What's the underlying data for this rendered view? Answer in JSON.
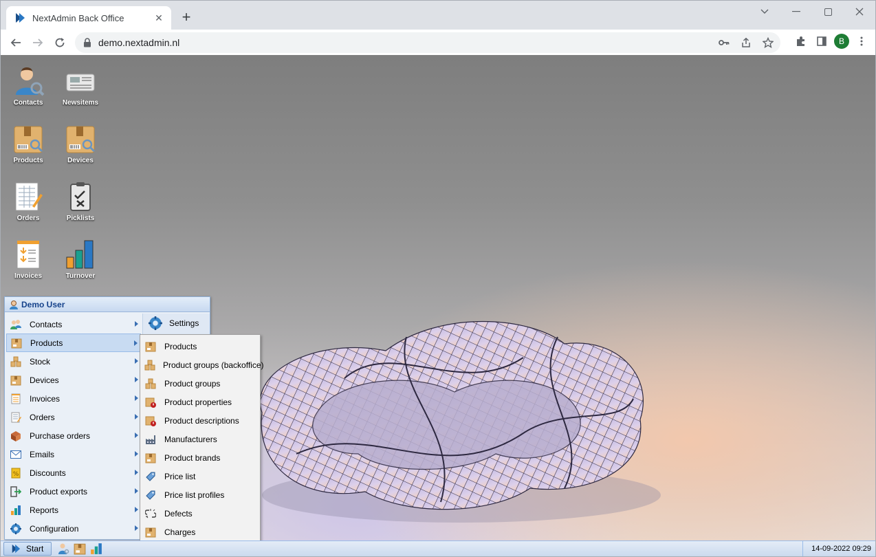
{
  "browser": {
    "tab_title": "NextAdmin Back Office",
    "url": "demo.nextadmin.nl",
    "profile_initial": "B"
  },
  "desktop": {
    "icons": [
      {
        "label": "Contacts",
        "icon": "contacts-icon"
      },
      {
        "label": "Newsitems",
        "icon": "newsitems-icon"
      },
      {
        "label": "Products",
        "icon": "products-icon"
      },
      {
        "label": "Devices",
        "icon": "devices-icon"
      },
      {
        "label": "Orders",
        "icon": "orders-icon"
      },
      {
        "label": "Picklists",
        "icon": "picklists-icon"
      },
      {
        "label": "Invoices",
        "icon": "invoices-icon"
      },
      {
        "label": "Turnover",
        "icon": "turnover-icon"
      }
    ]
  },
  "start_menu": {
    "user": "Demo User",
    "items": [
      {
        "label": "Contacts"
      },
      {
        "label": "Products"
      },
      {
        "label": "Stock"
      },
      {
        "label": "Devices"
      },
      {
        "label": "Invoices"
      },
      {
        "label": "Orders"
      },
      {
        "label": "Purchase orders"
      },
      {
        "label": "Emails"
      },
      {
        "label": "Discounts"
      },
      {
        "label": "Product exports"
      },
      {
        "label": "Reports"
      },
      {
        "label": "Configuration"
      }
    ],
    "active_item": "Products",
    "settings_label": "Settings"
  },
  "submenu": {
    "items": [
      {
        "label": "Products"
      },
      {
        "label": "Product groups (backoffice)"
      },
      {
        "label": "Product groups"
      },
      {
        "label": "Product properties"
      },
      {
        "label": "Product descriptions"
      },
      {
        "label": "Manufacturers"
      },
      {
        "label": "Product brands"
      },
      {
        "label": "Price list"
      },
      {
        "label": "Price list profiles"
      },
      {
        "label": "Defects"
      },
      {
        "label": "Charges"
      }
    ]
  },
  "taskbar": {
    "start_label": "Start",
    "clock": "14-09-2022 09:29"
  },
  "colors": {
    "accent": "#15428b",
    "menu_bg": "#eaf0f7",
    "active_bg": "#c8dbf2"
  }
}
